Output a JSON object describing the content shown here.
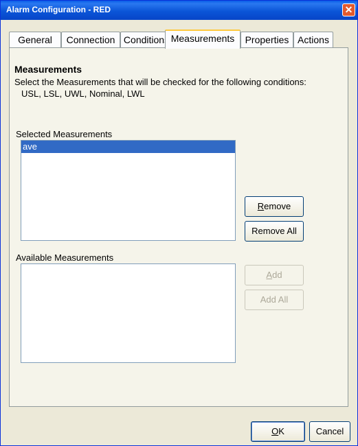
{
  "window": {
    "title": "Alarm Configuration - RED",
    "close_label": "✕"
  },
  "tabs": [
    {
      "label": "General"
    },
    {
      "label": "Connection"
    },
    {
      "label": "Conditions"
    },
    {
      "label": "Measurements"
    },
    {
      "label": "Properties"
    },
    {
      "label": "Actions"
    }
  ],
  "active_tab": "Measurements",
  "section": {
    "heading": "Measurements",
    "description": "Select the Measurements that will be checked for the following conditions:",
    "conditions": "USL, LSL, UWL, Nominal, LWL"
  },
  "selected": {
    "label": "Selected Measurements",
    "items": [
      "ave"
    ],
    "remove_label": "Remove",
    "remove_all_label": "Remove All"
  },
  "available": {
    "label": "Available Measurements",
    "items": [],
    "add_label": "Add",
    "add_all_label": "Add All"
  },
  "footer": {
    "ok_label": "OK",
    "cancel_label": "Cancel"
  }
}
